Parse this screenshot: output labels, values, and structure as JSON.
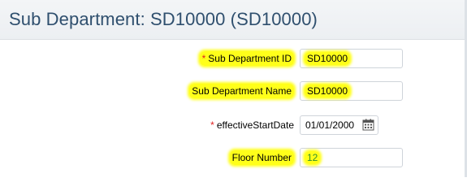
{
  "page": {
    "title": "Sub Department: SD10000 (SD10000)"
  },
  "form": {
    "fields": [
      {
        "label": "Sub Department ID",
        "required": "*",
        "value": "SD10000"
      },
      {
        "label": "Sub Department Name",
        "value": "SD10000"
      },
      {
        "label": "effectiveStartDate",
        "required": "*",
        "value": "01/01/2000",
        "icon": "calendar-icon"
      },
      {
        "label": "Floor Number",
        "value": "12"
      }
    ]
  },
  "colors": {
    "highlight": "#ffff1a",
    "title": "#2f4f6e",
    "required": "#e02020",
    "floor_value": "#2f8f2f"
  }
}
